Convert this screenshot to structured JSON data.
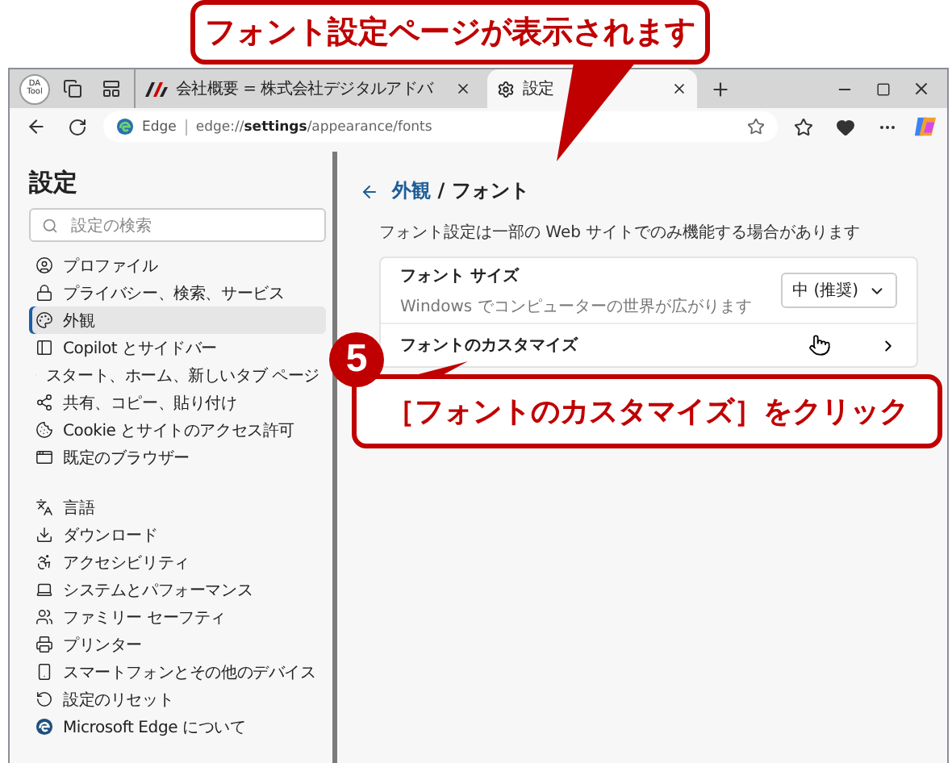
{
  "callouts": [
    {
      "kind": "note",
      "text": "フォント設定ページが表示されます"
    },
    {
      "kind": "step",
      "step": "5",
      "text": "［フォントのカスタマイズ］をクリック"
    }
  ],
  "browser": {
    "profile": "DA Tool",
    "tabs": [
      {
        "title": "会社概要 = 株式会社デジタルアドバ",
        "selected": false
      },
      {
        "title": "設定",
        "selected": true
      }
    ],
    "address": {
      "site_label": "Edge",
      "url": "edge://**settings**/appearance/fonts"
    }
  },
  "sidebar": {
    "title": "設定",
    "search": {
      "placeholder": "設定の検索"
    },
    "groups": [
      [
        {
          "label": "プロファイル",
          "selected": false
        },
        {
          "label": "プライバシー、検索、サービス",
          "selected": false
        },
        {
          "label": "外観",
          "selected": true
        },
        {
          "label": "Copilot とサイドバー",
          "selected": false
        },
        {
          "label": "スタート、ホーム、新しいタブ ページ",
          "selected": false
        },
        {
          "label": "共有、コピー、貼り付け",
          "selected": false
        },
        {
          "label": "Cookie とサイトのアクセス許可",
          "selected": false
        },
        {
          "label": "既定のブラウザー",
          "selected": false
        }
      ],
      [
        {
          "label": "言語",
          "selected": false
        },
        {
          "label": "ダウンロード",
          "selected": false
        },
        {
          "label": "アクセシビリティ",
          "selected": false
        },
        {
          "label": "システムとパフォーマンス",
          "selected": false
        },
        {
          "label": "ファミリー セーフティ",
          "selected": false
        },
        {
          "label": "プリンター",
          "selected": false
        },
        {
          "label": "スマートフォンとその他のデバイス",
          "selected": false
        },
        {
          "label": "設定のリセット",
          "selected": false
        }
      ]
    ],
    "footer": "Microsoft Edge について"
  },
  "page": {
    "breadcrumb": {
      "parent": "外観",
      "separator": "/",
      "current": "フォント"
    },
    "note": "フォント設定は一部の Web サイトでのみ機能する場合があります",
    "settings": [
      {
        "kind": "dropdown",
        "label": "フォント サイズ",
        "description": "Windows でコンピューターの世界が広がります",
        "value": "中 (推奨)"
      },
      {
        "kind": "link",
        "label": "フォントのカスタマイズ"
      }
    ]
  }
}
